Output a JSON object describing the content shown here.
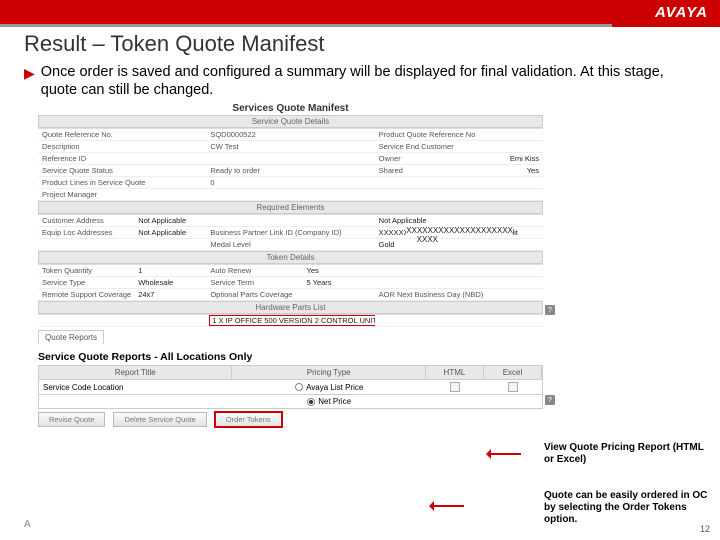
{
  "brand": {
    "logo": "AVAYA"
  },
  "slide": {
    "title": "Result – Token Quote Manifest",
    "bullet": "Once order is saved and configured a summary will be displayed for final validation. At this stage, quote can still be changed.",
    "page_num": "12",
    "foot_initial": "A"
  },
  "manifest": {
    "panel_title": "Services Quote Manifest",
    "sections": {
      "details": "Service Quote Details",
      "required": "Required Elements",
      "token": "Token Details",
      "hardware": "Hardware Parts List"
    },
    "details_rows": [
      {
        "l": "Quote Reference No.",
        "v": "SQD0000522",
        "l2": "Product Quote Reference No",
        "v2": ""
      },
      {
        "l": "Description",
        "v": "CW Test",
        "l2": "Service End Customer",
        "v2": ""
      },
      {
        "l": "Reference ID",
        "v": "",
        "l2": "Owner",
        "v2": "Emi Kiss"
      },
      {
        "l": "Service Quote Status",
        "v": "Ready to order",
        "l2": "Shared",
        "v2": "Yes"
      },
      {
        "l": "Product Lines in Service Quote",
        "v": "0",
        "l2": "",
        "v2": ""
      },
      {
        "l": "Project Manager",
        "v": "",
        "l2": "",
        "v2": ""
      }
    ],
    "required_rows": [
      {
        "l": "Customer Address",
        "v": "Not Applicable",
        "l2": "",
        "v2": "",
        "l3": "",
        "v3": "Not Applicable"
      },
      {
        "l": "Equip Loc Addresses",
        "v": "Not Applicable",
        "l2": "Business Partner Link ID (Company ID)",
        "v2": "XXXXXXXXXXXXXXXXXXXXXXXX6 Edit",
        "l3": "",
        "v3": ""
      },
      {
        "l": "",
        "v": "",
        "l2": "Medal Level",
        "v2": "Gold",
        "l3": "",
        "v3": ""
      }
    ],
    "overlay_x": "XXXXXXXXXXXXXXXXXXXX",
    "overlay_x2": "XXXX",
    "token_rows": [
      {
        "l": "Token Quantity",
        "v": "1",
        "l2": "Auto Renew",
        "v2": "Yes",
        "l3": "",
        "v3": ""
      },
      {
        "l": "Service Type",
        "v": "Wholesale",
        "l2": "Service Term",
        "v2": "5 Years",
        "l3": "",
        "v3": ""
      },
      {
        "l": "Remote Support Coverage",
        "v": "24x7",
        "l2": "Optional Parts Coverage",
        "v2": "",
        "l3": "AOR Next Business Day (NBD)",
        "v3": ""
      }
    ],
    "hardware_row": {
      "l": "",
      "v": "1 X IP OFFICE 500 VERSION 2 CONTROL UNIT"
    },
    "reports_tab": "Quote Reports",
    "help_icon": "?"
  },
  "reports": {
    "title": "Service Quote Reports - All Locations Only",
    "headers": {
      "c1": "Report Title",
      "c2": "Pricing Type",
      "c3": "HTML",
      "c4": "Excel"
    },
    "row1_label": "Service Code Location",
    "radio1": "Avaya List Price",
    "radio2": "Net Price"
  },
  "buttons": {
    "revise": "Revise Quote",
    "delete": "Delete Service Quote",
    "order": "Order Tokens"
  },
  "annotations": {
    "a1": "View Quote Pricing Report (HTML or Excel)",
    "a2": "Quote can be easily ordered in OC by selecting the Order Tokens option."
  }
}
